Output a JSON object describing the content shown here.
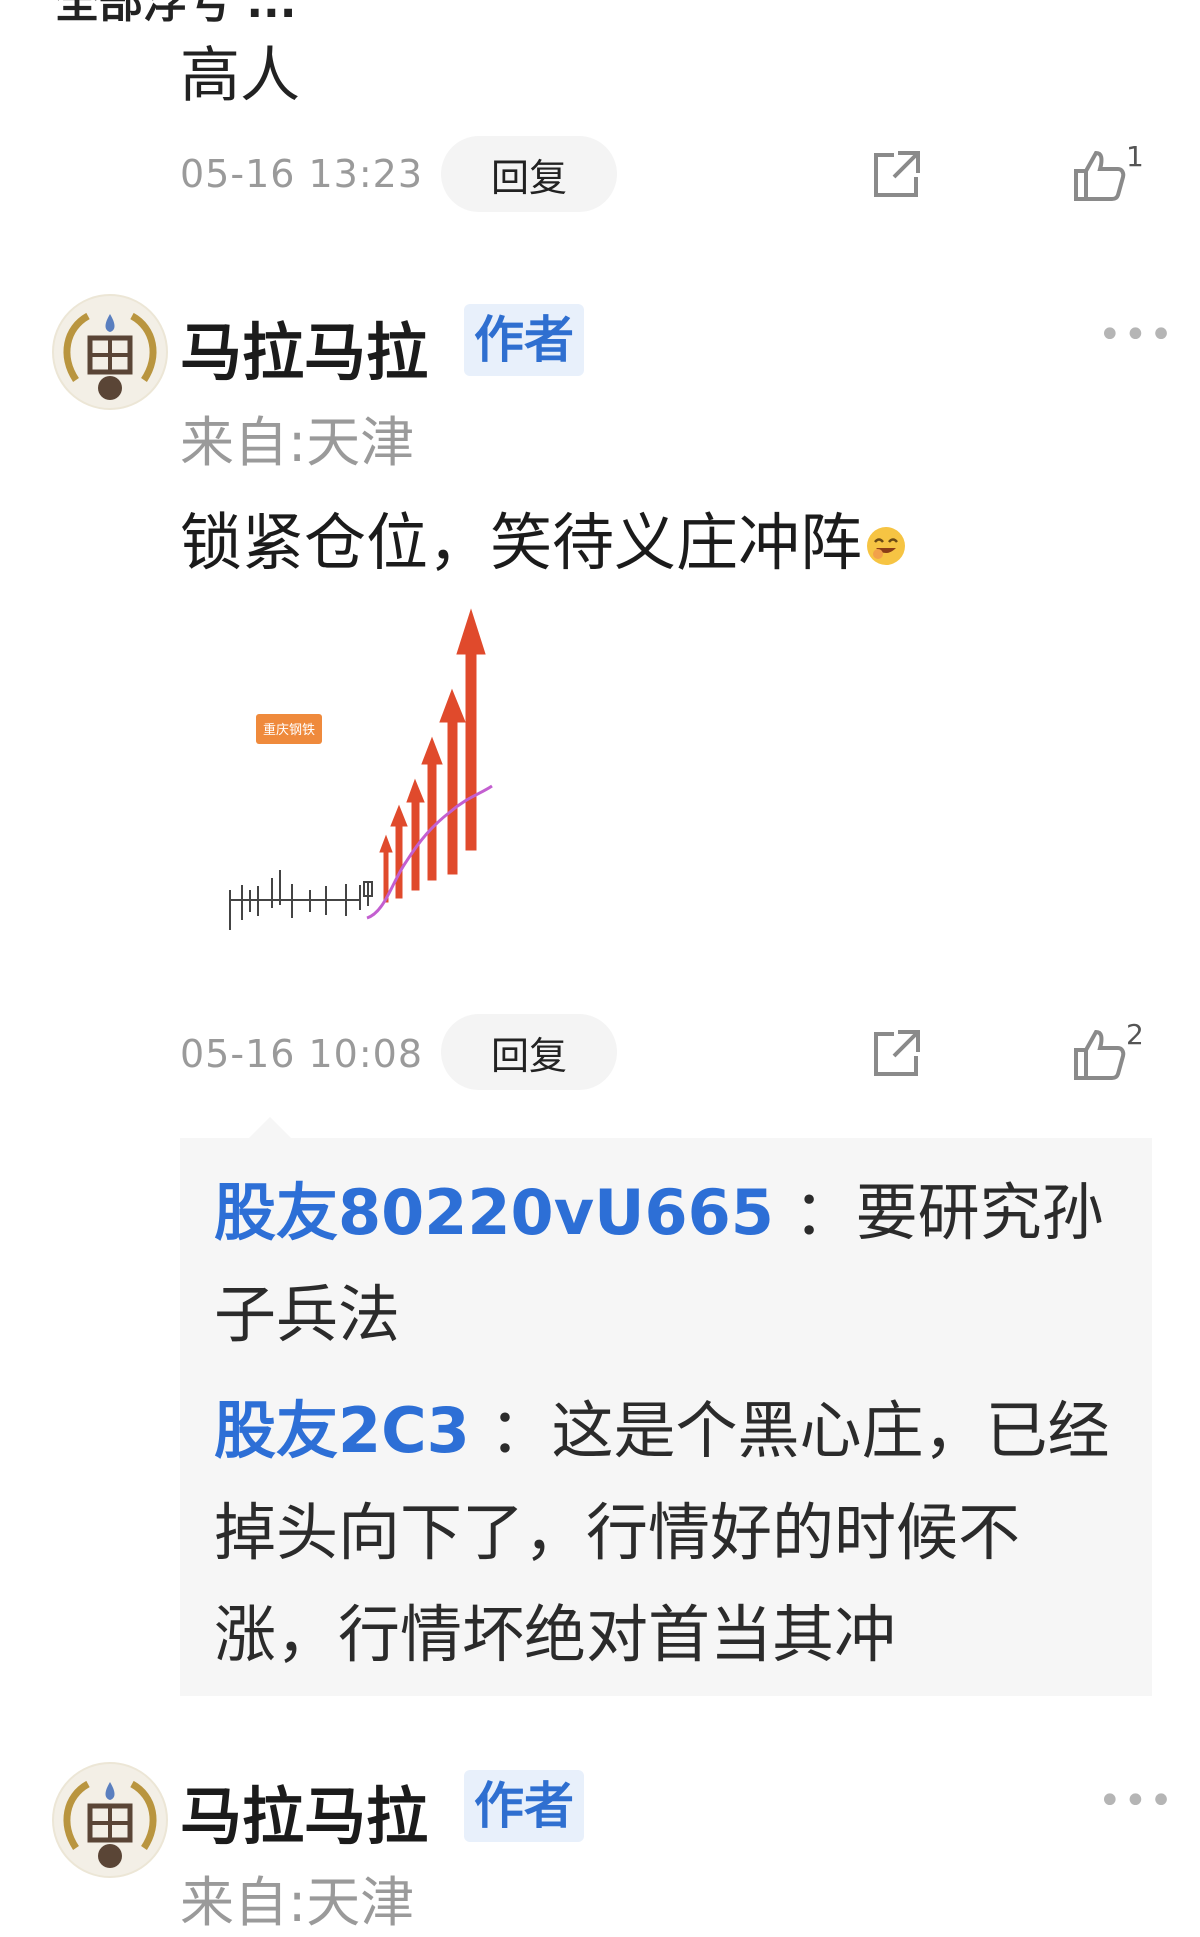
{
  "previous_comment": {
    "cut_text": "全部浮亏 ...",
    "body": "高人",
    "timestamp": "05-16 13:23",
    "reply_label": "回复",
    "like_count": "1"
  },
  "post": {
    "username": "马拉马拉",
    "author_badge": "作者",
    "location": "来自:天津",
    "text": "锁紧仓位，笑待义庄冲阵",
    "image_label": "重庆钢铁",
    "timestamp": "05-16 10:08",
    "reply_label": "回复",
    "like_count": "2",
    "replies": [
      {
        "user": "股友80220vU665",
        "sep": " ：",
        "text": "要研究孙子兵法"
      },
      {
        "user": "股友2C3",
        "sep": " ：",
        "text": "这是个黑心庄，已经掉头向下了，行情好的时候不涨，行情坏绝对首当其冲"
      }
    ]
  },
  "next_post": {
    "username": "马拉马拉",
    "author_badge": "作者",
    "location": "来自:天津"
  },
  "colors": {
    "accent_blue": "#2d6fd6",
    "arrow_red": "#e04a2c",
    "curve_purple": "#c35fd0",
    "badge_orange": "#ef8a3c"
  }
}
